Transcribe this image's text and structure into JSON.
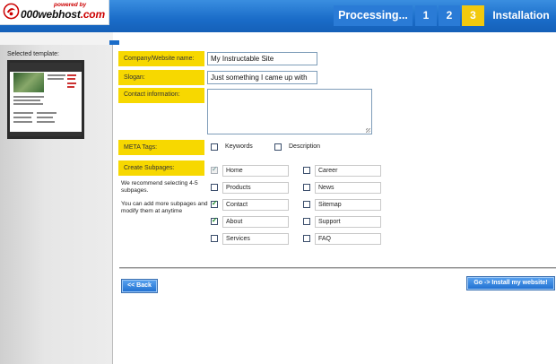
{
  "header": {
    "powered_by": "powered by",
    "logo_text": "000webhost",
    "logo_suffix": ".com",
    "steps": [
      {
        "label": "Processing...",
        "state": "inactive"
      },
      {
        "label": "1",
        "state": "inactive"
      },
      {
        "label": "2",
        "state": "inactive"
      },
      {
        "label": "3",
        "state": "active"
      },
      {
        "label": "Installation",
        "state": "inactive"
      }
    ]
  },
  "sidebar": {
    "selected_template_label": "Selected template:"
  },
  "form": {
    "company_label": "Company/Website name:",
    "company_value": "My Instructable Site",
    "slogan_label": "Slogan:",
    "slogan_value": "Just something I came up with",
    "contact_label": "Contact information:",
    "contact_value": "",
    "meta_label": "META Tags:",
    "meta_options": [
      {
        "label": "Keywords",
        "checked": false
      },
      {
        "label": "Description",
        "checked": false
      }
    ],
    "subpages_label": "Create Subpages:",
    "subpages_note_1": "We recommend selecting 4-5 subpages.",
    "subpages_note_2": "You can add more subpages and modify them at anytime",
    "subpages_left": [
      {
        "label": "Home",
        "checked": true,
        "disabled": true
      },
      {
        "label": "Products",
        "checked": false,
        "disabled": false
      },
      {
        "label": "Contact",
        "checked": true,
        "disabled": false
      },
      {
        "label": "About",
        "checked": true,
        "disabled": false
      },
      {
        "label": "Services",
        "checked": false,
        "disabled": false
      }
    ],
    "subpages_right": [
      {
        "label": "Career",
        "checked": false
      },
      {
        "label": "News",
        "checked": false
      },
      {
        "label": "Sitemap",
        "checked": false
      },
      {
        "label": "Support",
        "checked": false
      },
      {
        "label": "FAQ",
        "checked": false
      }
    ]
  },
  "buttons": {
    "back": "<< Back",
    "install": "Go -> Install my website!"
  },
  "colors": {
    "header_blue": "#1a6cc8",
    "active_step": "#f2c90d",
    "label_yellow": "#f7d800"
  }
}
